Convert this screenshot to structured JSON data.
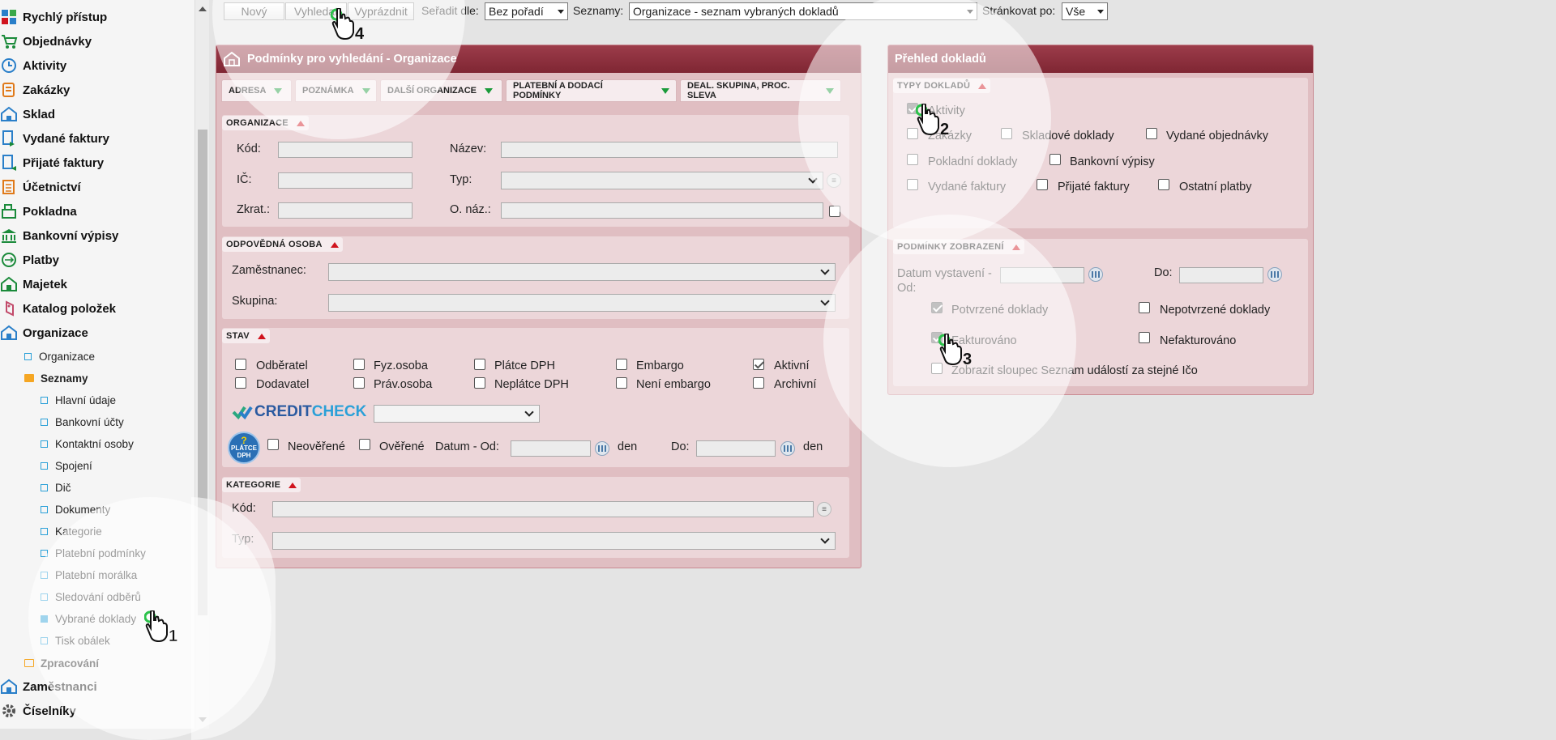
{
  "sidebar": {
    "items": [
      {
        "label": "Rychlý přístup",
        "icon": "grid-icon"
      },
      {
        "label": "Objednávky",
        "icon": "cart-icon"
      },
      {
        "label": "Aktivity",
        "icon": "clock-icon"
      },
      {
        "label": "Zakázky",
        "icon": "contract-icon"
      },
      {
        "label": "Sklad",
        "icon": "warehouse-icon"
      },
      {
        "label": "Vydané faktury",
        "icon": "invoice-out-icon"
      },
      {
        "label": "Přijaté faktury",
        "icon": "invoice-in-icon"
      },
      {
        "label": "Účetnictví",
        "icon": "ledger-icon"
      },
      {
        "label": "Pokladna",
        "icon": "cash-register-icon"
      },
      {
        "label": "Bankovní výpisy",
        "icon": "bank-icon"
      },
      {
        "label": "Platby",
        "icon": "payments-icon"
      },
      {
        "label": "Majetek",
        "icon": "assets-icon"
      },
      {
        "label": "Katalog položek",
        "icon": "catalog-icon"
      },
      {
        "label": "Organizace",
        "icon": "organization-icon"
      }
    ],
    "organizace_children": [
      {
        "label": "Organizace"
      },
      {
        "label": "Seznamy"
      }
    ],
    "seznamy_children": [
      {
        "label": "Hlavní údaje"
      },
      {
        "label": "Bankovní účty"
      },
      {
        "label": "Kontaktní osoby"
      },
      {
        "label": "Spojení"
      },
      {
        "label": "Dič"
      },
      {
        "label": "Dokumenty"
      },
      {
        "label": "Kategorie"
      },
      {
        "label": "Platební podmínky"
      },
      {
        "label": "Platební morálka"
      },
      {
        "label": "Sledování odběrů"
      },
      {
        "label": "Vybrané doklady"
      },
      {
        "label": "Tisk obálek"
      }
    ],
    "zpracovani": "Zpracování",
    "bottom_items": [
      {
        "label": "Zaměstnanci",
        "icon": "employees-icon"
      },
      {
        "label": "Číselníky",
        "icon": "gear-icon"
      }
    ]
  },
  "toolbar": {
    "novy": "Nový",
    "vyhledat": "Vyhledat",
    "vyprazdnit": "Vyprázdnit",
    "seradit_label": "Seřadit dle:",
    "seradit_value": "Bez pořadí",
    "seznamy_label": "Seznamy:",
    "seznamy_value": "Organizace - seznam vybraných dokladů",
    "strankovat_label": "Stránkovat po:",
    "strankovat_value": "Vše"
  },
  "left_panel": {
    "title": "Podmínky pro vyhledání - Organizace",
    "tabs": [
      "ADRESA",
      "POZNÁMKA",
      "DALŠÍ ORGANIZACE",
      "PLATEBNÍ A DODACÍ PODMÍNKY",
      "DEAL. SKUPINA, PROC. SLEVA"
    ],
    "organizace": {
      "title": "ORGANIZACE",
      "kod": "Kód:",
      "ic": "IČ:",
      "zkrat": "Zkrat.:",
      "nazev": "Název:",
      "typ": "Typ:",
      "o_naz": "O. náz.:"
    },
    "odpovedna": {
      "title": "ODPOVĚDNÁ OSOBA",
      "zamestnanec": "Zaměstnanec:",
      "skupina": "Skupina:"
    },
    "stav": {
      "title": "STAV",
      "checkboxes": [
        {
          "label": "Odběratel",
          "checked": false
        },
        {
          "label": "Fyz.osoba",
          "checked": false
        },
        {
          "label": "Plátce DPH",
          "checked": false
        },
        {
          "label": "Embargo",
          "checked": false
        },
        {
          "label": "Aktivní",
          "checked": true
        },
        {
          "label": "Dodavatel",
          "checked": false
        },
        {
          "label": "Práv.osoba",
          "checked": false
        },
        {
          "label": "Neplátce DPH",
          "checked": false
        },
        {
          "label": "Není embargo",
          "checked": false
        },
        {
          "label": "Archivní",
          "checked": false
        }
      ],
      "creditcheck_brand": "CREDIT",
      "creditcheck_brand2": "CHECK",
      "platce_badge_line1": "PLÁTCE",
      "platce_badge_line2": "DPH",
      "neoverene": "Neověřené",
      "overene": "Ověřené",
      "datum_od": "Datum - Od:",
      "den": "den",
      "do": "Do:"
    },
    "kategorie": {
      "title": "KATEGORIE",
      "kod": "Kód:",
      "typ": "Typ:"
    }
  },
  "right_panel": {
    "title": "Přehled dokladů",
    "typy": {
      "title": "TYPY DOKLADŮ",
      "checkboxes": [
        {
          "label": "Aktivity",
          "checked": true
        },
        {
          "label": "Zakázky",
          "checked": false
        },
        {
          "label": "Skladové doklady",
          "checked": false
        },
        {
          "label": "Vydané objednávky",
          "checked": false
        },
        {
          "label": "Pokladní doklady",
          "checked": false
        },
        {
          "label": "Bankovní výpisy",
          "checked": false
        },
        {
          "label": "Vydané faktury",
          "checked": false
        },
        {
          "label": "Přijaté faktury",
          "checked": false
        },
        {
          "label": "Ostatní platby",
          "checked": false
        }
      ]
    },
    "podminky": {
      "title": "PODMÍNKY ZOBRAZENÍ",
      "datum_label_1": "Datum vystavení -",
      "datum_label_2": "Od:",
      "do": "Do:",
      "potvrzene": "Potvrzené doklady",
      "nepotvrzene": "Nepotvrzené doklady",
      "fakturovano": "Fakturováno",
      "nefakturovano": "Nefakturováno",
      "zobrazit": "Zobrazit sloupec Seznam událostí za stejné Ičo"
    }
  },
  "steps": [
    "1",
    "2",
    "3",
    "4"
  ],
  "colors": {
    "panel_header": "#8a2e3b",
    "panel_bg": "#e0bec2",
    "accent_blue": "#2aa0d8",
    "arrow_red": "#d0141e",
    "arrow_green": "#1a9a3a"
  }
}
